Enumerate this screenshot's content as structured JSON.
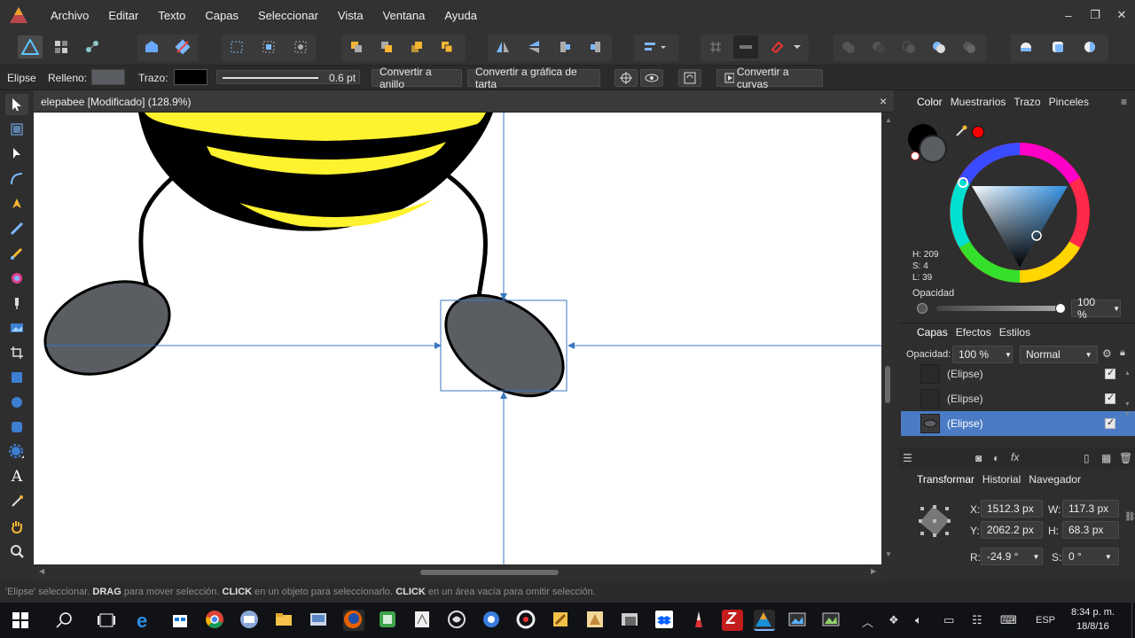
{
  "menu": {
    "items": [
      "Archivo",
      "Editar",
      "Texto",
      "Capas",
      "Seleccionar",
      "Vista",
      "Ventana",
      "Ayuda"
    ],
    "window_controls": [
      "–",
      "❐",
      "✕"
    ]
  },
  "context_toolbar": {
    "shape_label": "Elipse",
    "fill_label": "Relleno:",
    "stroke_label": "Trazo:",
    "stroke_width": "0.6 pt",
    "convert_ring": "Convertir a anillo",
    "convert_pie": "Convertir a gráfica de tarta",
    "convert_curves": "Convertir a curvas"
  },
  "document": {
    "tab_title": "elepabee [Modificado] (128.9%)",
    "close": "×"
  },
  "color_panel": {
    "tabs": [
      "Color",
      "Muestrarios",
      "Trazo",
      "Pinceles"
    ],
    "h": "H: 209",
    "s": "S: 4",
    "l": "L: 39",
    "opacity_label": "Opacidad",
    "opacity_value": "100 %",
    "current_color": "#5a5d62",
    "secondary_color": "#ff0000"
  },
  "layers_panel": {
    "tabs": [
      "Capas",
      "Efectos",
      "Estilos"
    ],
    "opacity_label": "Opacidad:",
    "opacity_value": "100 %",
    "blend_mode": "Normal",
    "layers": [
      {
        "name": "(Elipse)",
        "selected": false
      },
      {
        "name": "(Elipse)",
        "selected": false
      },
      {
        "name": "(Elipse)",
        "selected": true
      }
    ]
  },
  "transform_panel": {
    "tabs": [
      "Transformar",
      "Historial",
      "Navegador"
    ],
    "x_label": "X:",
    "x_value": "1512.3 px",
    "y_label": "Y:",
    "y_value": "2062.2 px",
    "w_label": "W:",
    "w_value": "117.3 px",
    "h_label": "H:",
    "h_value": "68.3 px",
    "r_label": "R:",
    "r_value": "-24.9 °",
    "s_label": "S:",
    "s_value": "0 °"
  },
  "status": {
    "part1": "'Elipse' seleccionar.",
    "drag": "DRAG",
    "part2": "para mover selección.",
    "click1": "CLICK",
    "part3": "en un objeto para seleccionarlo.",
    "click2": "CLICK",
    "part4": "en un área vacía para omitir selección."
  },
  "taskbar": {
    "language": "ESP",
    "time": "8:34 p. m.",
    "date": "18/8/16"
  },
  "colors": {
    "accent": "#4a7bc4",
    "ellipse_fill": "#5a5d62",
    "bee_yellow": "#fff22e",
    "guide_blue": "#3a78c2"
  }
}
